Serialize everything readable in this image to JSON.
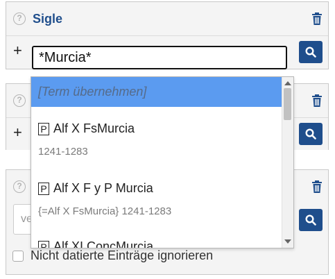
{
  "panel1": {
    "title": "Sigle"
  },
  "search": {
    "value": "*Murcia*"
  },
  "dropdown": {
    "highlight": "[Term übernehmen]",
    "entries": [
      {
        "badge": "P",
        "label": "Alf X FsMurcia",
        "sub": "1241-1283"
      },
      {
        "badge": "P",
        "label": "Alf X F y P Murcia",
        "sub": "{=Alf X FsMurcia} 1241-1283"
      },
      {
        "badge": "P",
        "label": "Alf XI ConcMurcia"
      }
    ]
  },
  "panel3": {
    "input_placeholder": "ve"
  },
  "checkbox": {
    "label": "Nicht datierte Einträge ignorieren"
  },
  "colors": {
    "accent": "#1f4e8c",
    "highlight": "#5b9bf0"
  },
  "icons": [
    "help-icon",
    "trash-icon",
    "plus-icon",
    "search-icon"
  ]
}
